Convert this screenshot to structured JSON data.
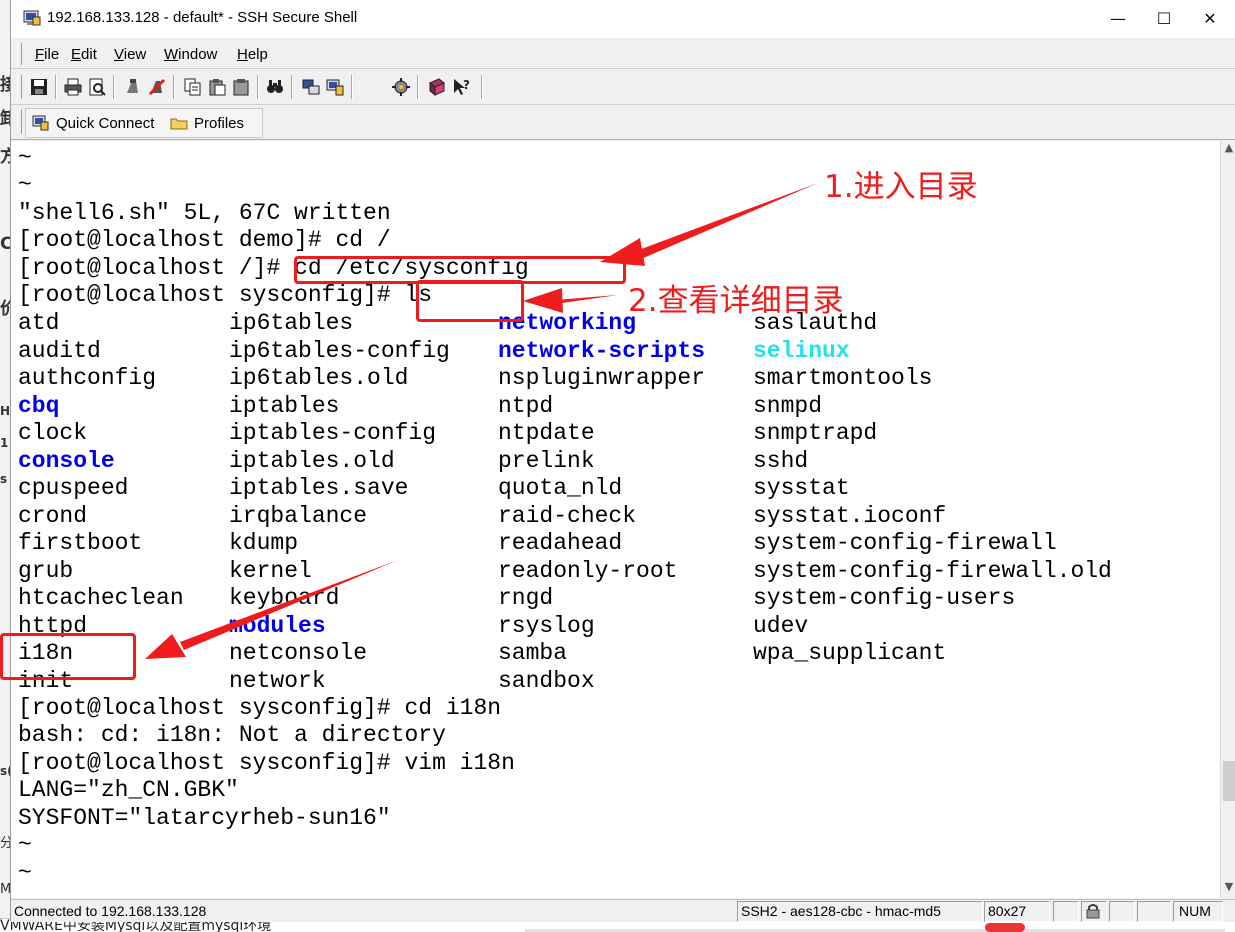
{
  "window": {
    "title": "192.168.133.128 - default* - SSH Secure Shell",
    "min_glyph": "—",
    "max_glyph": "☐",
    "close_glyph": "✕"
  },
  "menu": {
    "items": [
      {
        "key": "F",
        "rest": "ile"
      },
      {
        "key": "E",
        "rest": "dit"
      },
      {
        "key": "V",
        "rest": "iew"
      },
      {
        "key": "W",
        "rest": "indow"
      },
      {
        "key": "H",
        "rest": "elp"
      }
    ]
  },
  "toolbar": {
    "icons": [
      "save-icon",
      "print-icon",
      "print-preview-icon",
      "disconnect-icon",
      "connect-icon",
      "copy-icon",
      "paste-icon",
      "paste-plain-icon",
      "find-icon",
      "file-transfer-icon",
      "new-terminal-icon",
      "settings-icon",
      "help-book-icon",
      "context-help-icon"
    ]
  },
  "toolbar2": {
    "quick_connect": "Quick Connect",
    "profiles": "Profiles"
  },
  "terminal": {
    "lines": [
      "~",
      "~",
      "\"shell6.sh\" 5L, 67C written",
      "[root@localhost demo]# cd /",
      "[root@localhost /]# cd /etc/sysconfig",
      "[root@localhost sysconfig]# ls"
    ],
    "listing": [
      [
        "atd",
        "ip6tables",
        "networking",
        "saslauthd"
      ],
      [
        "auditd",
        "ip6tables-config",
        "network-scripts",
        "selinux"
      ],
      [
        "authconfig",
        "ip6tables.old",
        "nspluginwrapper",
        "smartmontools"
      ],
      [
        "cbq",
        "iptables",
        "ntpd",
        "snmpd"
      ],
      [
        "clock",
        "iptables-config",
        "ntpdate",
        "snmptrapd"
      ],
      [
        "console",
        "iptables.old",
        "prelink",
        "sshd"
      ],
      [
        "cpuspeed",
        "iptables.save",
        "quota_nld",
        "sysstat"
      ],
      [
        "crond",
        "irqbalance",
        "raid-check",
        "sysstat.ioconf"
      ],
      [
        "firstboot",
        "kdump",
        "readahead",
        "system-config-firewall"
      ],
      [
        "grub",
        "kernel",
        "readonly-root",
        "system-config-firewall.old"
      ],
      [
        "htcacheclean",
        "keyboard",
        "rngd",
        "system-config-users"
      ],
      [
        "httpd",
        "modules",
        "rsyslog",
        "udev"
      ],
      [
        "i18n",
        "netconsole",
        "samba",
        "wpa_supplicant"
      ],
      [
        "init",
        "network",
        "sandbox",
        ""
      ]
    ],
    "listing_styles": {
      "networking": "dir",
      "network-scripts": "dir",
      "selinux": "cyan",
      "cbq": "dir",
      "console": "dir",
      "modules": "dir"
    },
    "after": [
      "[root@localhost sysconfig]# cd i18n",
      "bash: cd: i18n: Not a directory",
      "[root@localhost sysconfig]# vim i18n",
      "LANG=\"zh_CN.GBK\"",
      "SYSFONT=\"latarcyrheb-sun16\"",
      "~",
      "~"
    ]
  },
  "annotations": {
    "step1": "1.进入目录",
    "step2": "2.查看详细目录"
  },
  "statusbar": {
    "connected": "Connected to 192.168.133.128",
    "cipher": "SSH2 - aes128-cbc - hmac-md5",
    "size": "80x27",
    "num": "NUM"
  },
  "background": {
    "left_chars": [
      "接",
      "卸",
      "方",
      "C",
      "价",
      "H",
      "1",
      "s",
      "s(",
      "分",
      "M"
    ],
    "bottom_text": "VMWARE中安装Mysql以及配置mysql环境"
  },
  "colors": {
    "accent_red": "#ee1c1c",
    "dir_blue": "#0000ee",
    "cyan": "#22e0ee"
  }
}
